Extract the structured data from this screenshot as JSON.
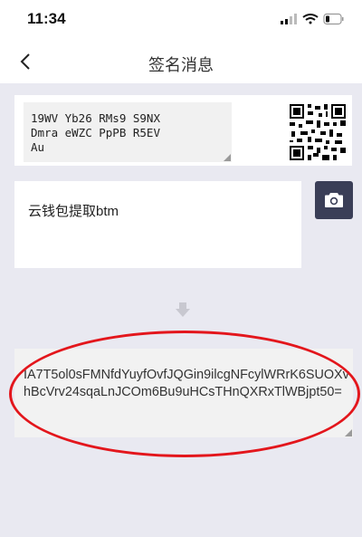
{
  "status_bar": {
    "time": "11:34"
  },
  "nav": {
    "title": "签名消息"
  },
  "address": {
    "lines": [
      "19WV Yb26 RMs9 S9NX",
      "Dmra eWZC PpPB R5EV",
      "Au"
    ]
  },
  "message": {
    "value": "云钱包提取btm"
  },
  "signature": {
    "value": "IA7T5ol0sFMNfdYuyfOvfJQGin9ilcgNFcylWRrK6SUOXvhBcVrv24sqaLnJCOm6Bu9uHCsTHnQXRxTlWBjpt50="
  },
  "icons": {
    "back": "chevron-left-icon",
    "qr": "qr-code-icon",
    "camera": "camera-icon",
    "arrow": "arrow-down-icon",
    "signal": "signal-icon",
    "wifi": "wifi-icon",
    "battery": "battery-icon"
  },
  "colors": {
    "background": "#e9e9f1",
    "camera_button": "#3a3e57",
    "highlight": "#e3161c"
  }
}
